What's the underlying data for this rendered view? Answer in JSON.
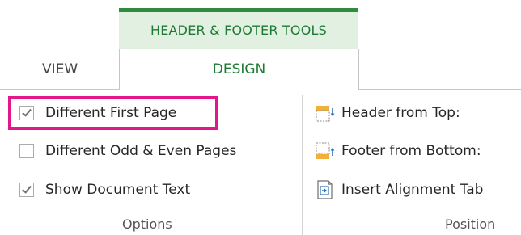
{
  "contextual_tab_group": {
    "title": "HEADER & FOOTER TOOLS"
  },
  "tabs": [
    {
      "label": "VIEW"
    },
    {
      "label": "DESIGN"
    }
  ],
  "options_group": {
    "label": "Options",
    "items": [
      {
        "label": "Different First Page",
        "checked": true
      },
      {
        "label": "Different Odd & Even Pages",
        "checked": false
      },
      {
        "label": "Show Document Text",
        "checked": true
      }
    ]
  },
  "position_group": {
    "label": "Position",
    "items": [
      {
        "label": "Header from Top:",
        "icon": "header-from-top-icon"
      },
      {
        "label": "Footer from Bottom:",
        "icon": "footer-from-bottom-icon"
      },
      {
        "label": "Insert Alignment Tab",
        "icon": "insert-alignment-tab-icon"
      }
    ]
  },
  "colors": {
    "accent_green": "#2e8b3f",
    "contextual_band": "#e2f0e2",
    "highlight": "#e3168b"
  }
}
